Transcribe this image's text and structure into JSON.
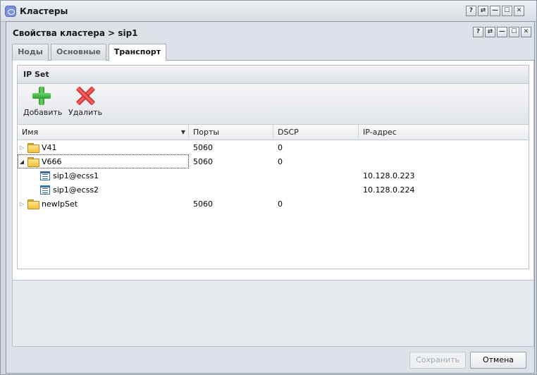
{
  "outer_window": {
    "title": "Кластеры",
    "buttons": [
      "?",
      "⇄",
      "—",
      "☐",
      "✕"
    ]
  },
  "dialog": {
    "title": "Свойства кластера > sip1",
    "buttons": [
      "?",
      "⇄",
      "—",
      "☐",
      "✕"
    ],
    "tabs": [
      {
        "label": "Ноды",
        "active": false
      },
      {
        "label": "Основные",
        "active": false
      },
      {
        "label": "Транспорт",
        "active": true
      }
    ]
  },
  "ipset_panel": {
    "title": "IP Set",
    "toolbar": {
      "add_label": "Добавить",
      "delete_label": "Удалить"
    },
    "columns": [
      "Имя",
      "Порты",
      "DSCP",
      "IP-адрес"
    ],
    "rows": [
      {
        "name": "V41",
        "ports": "5060",
        "dscp": "0",
        "ip": "",
        "type": "folder",
        "expanded": false,
        "level": 0
      },
      {
        "name": "V666",
        "ports": "5060",
        "dscp": "0",
        "ip": "",
        "type": "folder",
        "expanded": true,
        "level": 0
      },
      {
        "name": "sip1@ecss1",
        "ports": "",
        "dscp": "",
        "ip": "10.128.0.223",
        "type": "leaf",
        "level": 1
      },
      {
        "name": "sip1@ecss2",
        "ports": "",
        "dscp": "",
        "ip": "10.128.0.224",
        "type": "leaf",
        "level": 1
      },
      {
        "name": "newIpSet",
        "ports": "5060",
        "dscp": "0",
        "ip": "",
        "type": "folder",
        "expanded": false,
        "level": 0
      }
    ]
  },
  "footer": {
    "save_label": "Сохранить",
    "cancel_label": "Отмена"
  }
}
